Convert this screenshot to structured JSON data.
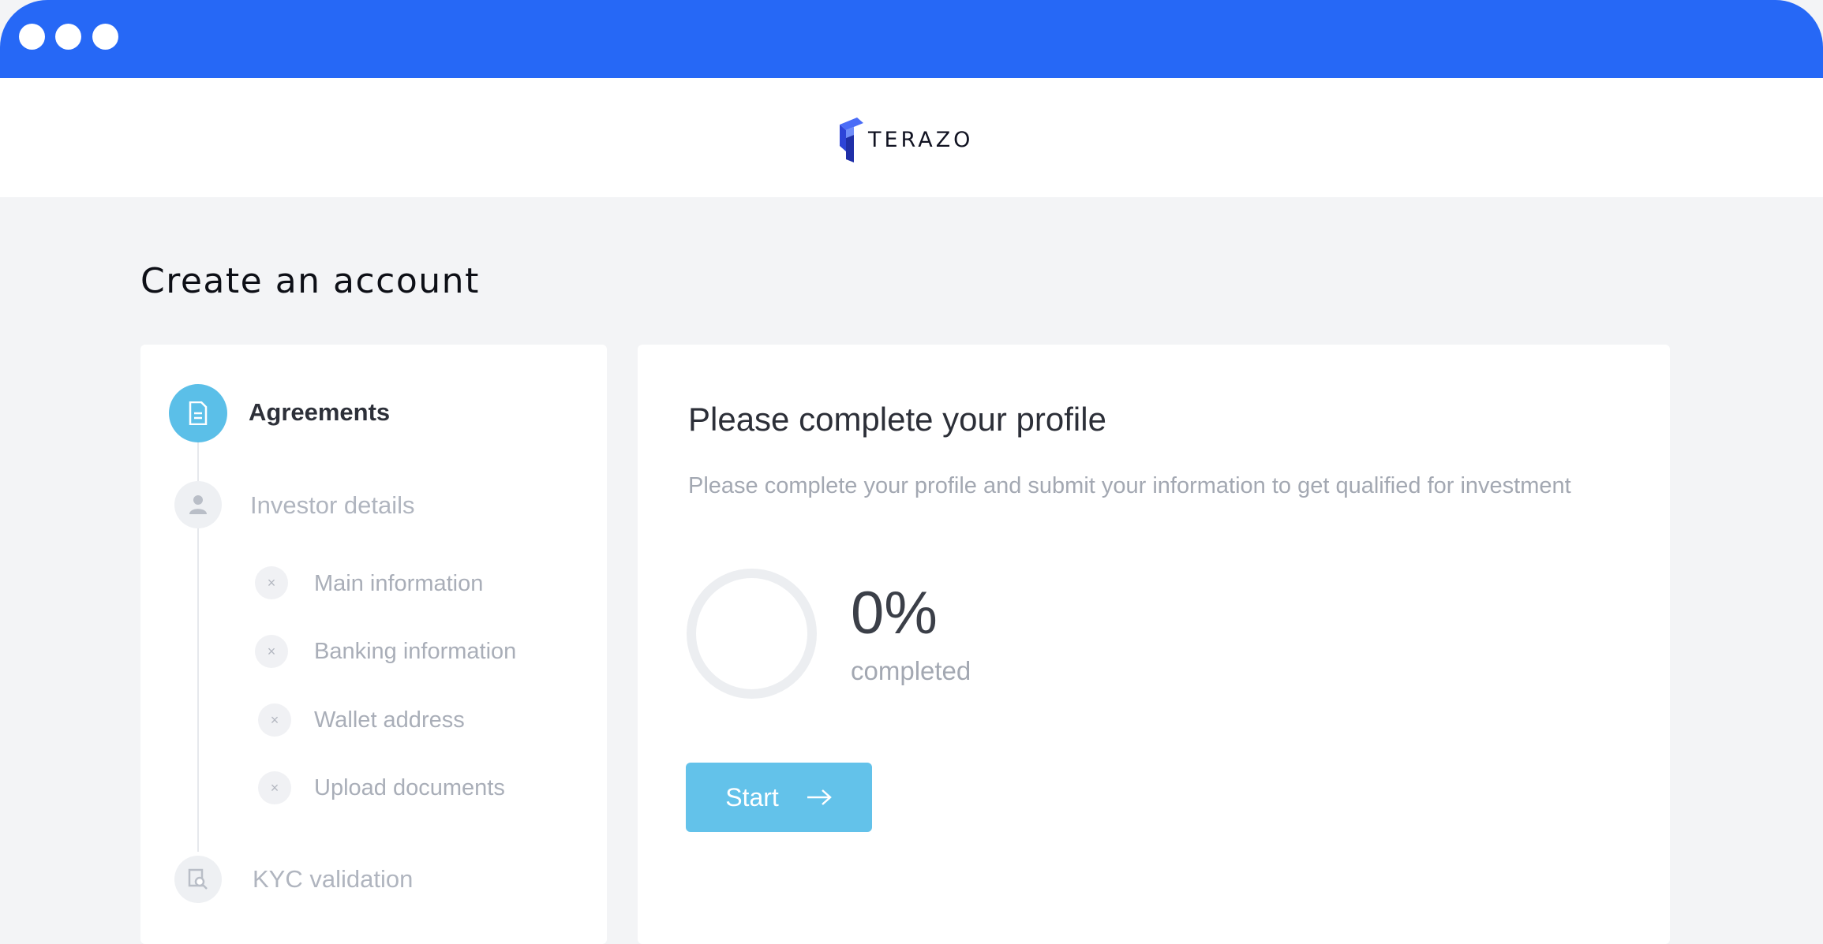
{
  "window": {
    "controls": [
      "close",
      "minimize",
      "maximize"
    ]
  },
  "header": {
    "logo_text": "TERAZO",
    "logo_icon": "terazo-logo-icon"
  },
  "page": {
    "title": "Create an account"
  },
  "steps": {
    "main": [
      {
        "label": "Agreements",
        "icon": "document-icon",
        "state": "active"
      },
      {
        "label": "Investor details",
        "icon": "user-icon",
        "state": "inactive"
      },
      {
        "label": "KYC validation",
        "icon": "id-search-icon",
        "state": "inactive"
      }
    ],
    "sub": [
      {
        "label": "Main information",
        "status_icon": "close-icon"
      },
      {
        "label": "Banking information",
        "status_icon": "close-icon"
      },
      {
        "label": "Wallet address",
        "status_icon": "close-icon"
      },
      {
        "label": "Upload documents",
        "status_icon": "close-icon"
      }
    ]
  },
  "profile": {
    "title": "Please complete your profile",
    "description": "Please complete your profile and submit your information to get qualified for investment",
    "progress_value": "0%",
    "progress_fraction": 0,
    "progress_label": "completed",
    "start_label": "Start",
    "start_icon": "arrow-right-icon"
  },
  "colors": {
    "titlebar": "#2668f6",
    "accent": "#5bbfe8",
    "button": "#63c2ea",
    "background": "#f3f4f6"
  }
}
